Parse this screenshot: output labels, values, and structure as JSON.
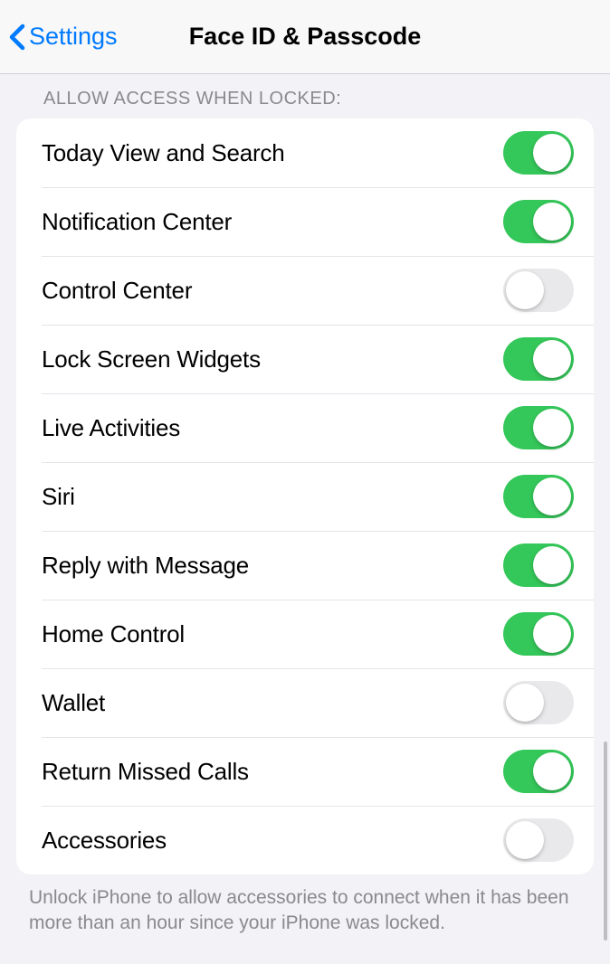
{
  "nav": {
    "back_label": "Settings",
    "title": "Face ID & Passcode"
  },
  "section": {
    "header": "Allow Access When Locked:",
    "footer": "Unlock iPhone to allow accessories to connect when it has been more than an hour since your iPhone was locked."
  },
  "items": [
    {
      "label": "Today View and Search",
      "on": true
    },
    {
      "label": "Notification Center",
      "on": true
    },
    {
      "label": "Control Center",
      "on": false
    },
    {
      "label": "Lock Screen Widgets",
      "on": true
    },
    {
      "label": "Live Activities",
      "on": true
    },
    {
      "label": "Siri",
      "on": true
    },
    {
      "label": "Reply with Message",
      "on": true
    },
    {
      "label": "Home Control",
      "on": true
    },
    {
      "label": "Wallet",
      "on": false
    },
    {
      "label": "Return Missed Calls",
      "on": true
    },
    {
      "label": "Accessories",
      "on": false
    }
  ]
}
